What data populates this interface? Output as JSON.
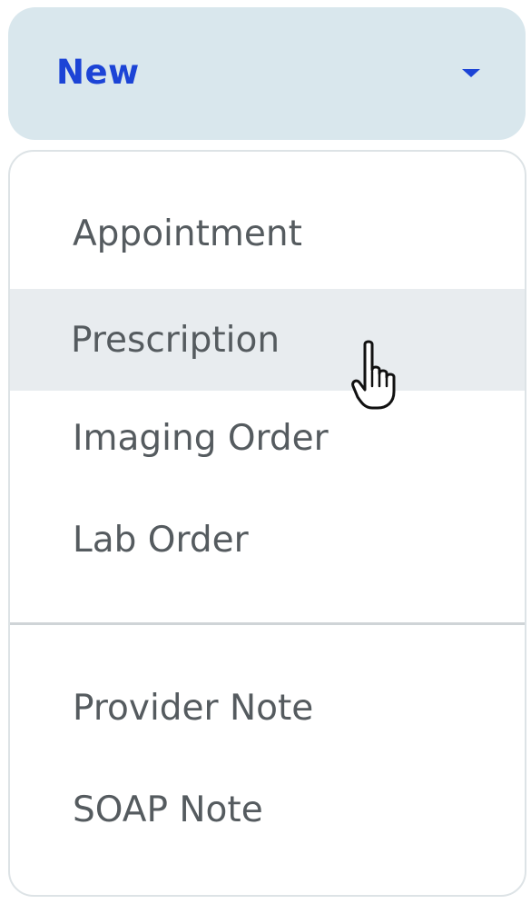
{
  "new_button": {
    "label": "New",
    "icon": "caret-down-icon"
  },
  "menu": {
    "items": [
      {
        "label": "Appointment",
        "hovered": false
      },
      {
        "label": "Prescription",
        "hovered": true
      },
      {
        "label": "Imaging Order",
        "hovered": false
      },
      {
        "label": "Lab Order",
        "hovered": false
      },
      {
        "label": "Provider Note",
        "hovered": false
      },
      {
        "label": "SOAP Note",
        "hovered": false
      }
    ]
  },
  "cursor": {
    "icon": "hand-pointer-icon"
  },
  "colors": {
    "accent": "#1c44d6",
    "button_bg": "#d9e7ed",
    "hover_bg": "#e8ecef",
    "text": "#555b5f"
  }
}
